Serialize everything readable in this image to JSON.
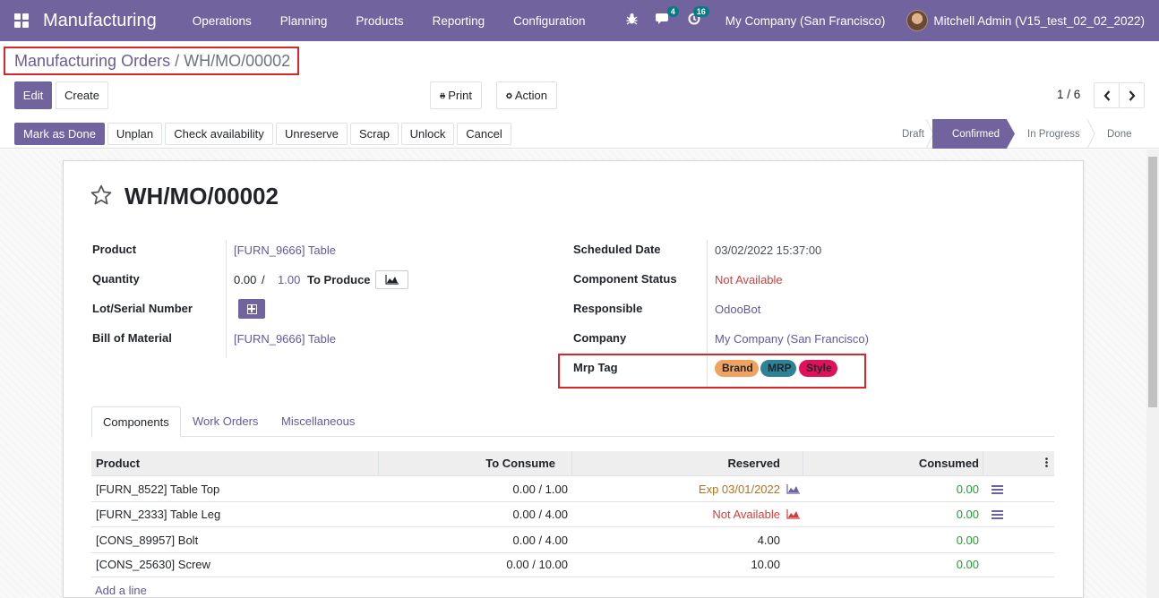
{
  "navbar": {
    "app_name": "Manufacturing",
    "menu": [
      "Operations",
      "Planning",
      "Products",
      "Reporting",
      "Configuration"
    ],
    "messages_count": "4",
    "activities_count": "16",
    "company": "My Company (San Francisco)",
    "user": "Mitchell Admin (V15_test_02_02_2022)"
  },
  "breadcrumb": {
    "parent": "Manufacturing Orders",
    "separator": "/",
    "current": "WH/MO/00002"
  },
  "control_panel": {
    "edit": "Edit",
    "create": "Create",
    "print": "Print",
    "action": "Action",
    "pager": "1 / 6"
  },
  "statusbar": {
    "buttons": [
      "Mark as Done",
      "Unplan",
      "Check availability",
      "Unreserve",
      "Scrap",
      "Unlock",
      "Cancel"
    ],
    "stages": [
      "Draft",
      "Confirmed",
      "In Progress",
      "Done"
    ],
    "active_stage": "Confirmed"
  },
  "record": {
    "title": "WH/MO/00002",
    "left_fields": {
      "product_label": "Product",
      "product_value": "[FURN_9666] Table",
      "quantity_label": "Quantity",
      "quantity_produced": "0.00",
      "quantity_sep": "/",
      "quantity_total": "1.00",
      "to_produce": "To Produce",
      "lot_label": "Lot/Serial Number",
      "bom_label": "Bill of Material",
      "bom_value": "[FURN_9666] Table"
    },
    "right_fields": {
      "scheduled_label": "Scheduled Date",
      "scheduled_value": "03/02/2022 15:37:00",
      "component_status_label": "Component Status",
      "component_status_value": "Not Available",
      "responsible_label": "Responsible",
      "responsible_value": "OdooBot",
      "company_label": "Company",
      "company_value": "My Company (San Francisco)",
      "mrp_tag_label": "Mrp Tag"
    },
    "tags": [
      {
        "label": "Brand",
        "color": "#f0a35e"
      },
      {
        "label": "MRP",
        "color": "#2c8397"
      },
      {
        "label": "Style",
        "color": "#e2105b"
      }
    ]
  },
  "tabs": [
    "Components",
    "Work Orders",
    "Miscellaneous"
  ],
  "components_table": {
    "headers": [
      "Product",
      "To Consume",
      "Reserved",
      "Consumed"
    ],
    "rows": [
      {
        "product": "[FURN_8522] Table Top",
        "to_consume": "0.00 / 1.00",
        "reserved": "Exp 03/01/2022",
        "reserved_color": "#b5701a",
        "consumed": "0.00"
      },
      {
        "product": "[FURN_2333] Table Leg",
        "to_consume": "0.00 / 4.00",
        "reserved": "Not Available",
        "reserved_color": "#d23f3a",
        "consumed": "0.00"
      },
      {
        "product": "[CONS_89957] Bolt",
        "to_consume": "0.00 / 4.00",
        "reserved": "4.00",
        "reserved_color": "#212529",
        "consumed": "0.00"
      },
      {
        "product": "[CONS_25630] Screw",
        "to_consume": "0.00 / 10.00",
        "reserved": "10.00",
        "reserved_color": "#212529",
        "consumed": "0.00"
      }
    ],
    "add_line": "Add a line"
  }
}
